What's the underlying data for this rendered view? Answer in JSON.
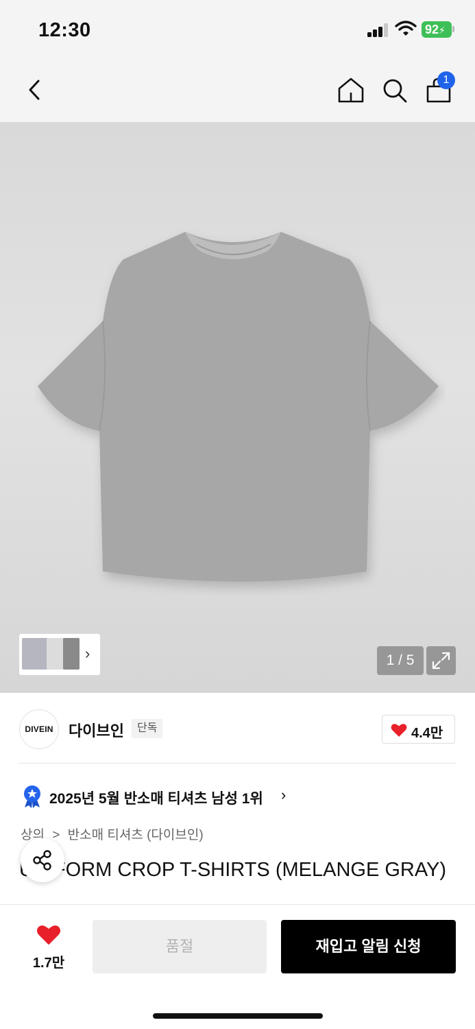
{
  "status_bar": {
    "time": "12:30",
    "battery": "92"
  },
  "nav": {
    "cart_count": "1"
  },
  "gallery": {
    "page_indicator": "1 / 5"
  },
  "brand": {
    "logo_text": "DIVEIN",
    "name": "다이브인",
    "tag": "단독",
    "likes": "4.4만"
  },
  "ranking": {
    "text": "2025년 5월 반소매 티셔츠 남성 1위"
  },
  "breadcrumb": {
    "level1": "상의",
    "separator": ">",
    "level2": "반소매 티셔츠 (다이브인)"
  },
  "product": {
    "title": "UNIFORM CROP T-SHIRTS (MELANGE GRAY)"
  },
  "bottom_bar": {
    "wish_count": "1.7만",
    "soldout_label": "품절",
    "restock_label": "재입고 알림 신청"
  },
  "colors": {
    "accent_blue": "#1f63ea",
    "heart_red": "#e8202a",
    "battery_green": "#3fbf58"
  }
}
